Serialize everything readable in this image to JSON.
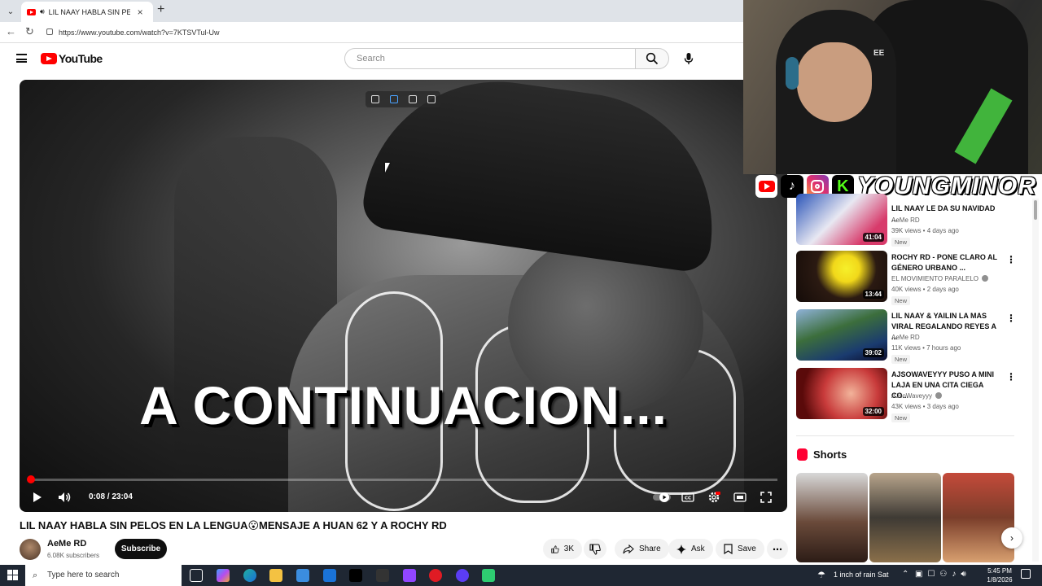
{
  "browser": {
    "tab_title": "LIL NAAY HABLA SIN PELOS E",
    "url": "https://www.youtube.com/watch?v=7KTSVTul-Uw"
  },
  "header": {
    "logo_text": "YouTube",
    "search_placeholder": "Search"
  },
  "player": {
    "overlay_text": "A CONTINUACION...",
    "time_display": "0:08 / 23:04",
    "progress_fraction": 0.0058
  },
  "video": {
    "title": "LIL NAAY HABLA SIN PELOS EN LA LENGUA😮MENSAJE A HUAN 62 Y A ROCHY RD",
    "channel_name": "AeMe RD",
    "subscribers": "6.08K subscribers",
    "subscribe_label": "Subscribe",
    "like_count": "3K",
    "share_label": "Share",
    "ask_label": "Ask",
    "save_label": "Save"
  },
  "webcam": {
    "hood_text": "EE",
    "overlay_brand": "YOUNGMINOR"
  },
  "sidebar": {
    "recommendations": [
      {
        "title": "LIL NAAY LE DA SU NAVIDAD ...",
        "channel": "AeMe RD",
        "verified": false,
        "meta": "39K views • 4 days ago",
        "badge": "New",
        "duration": "41:04"
      },
      {
        "title": "ROCHY RD - PONE CLARO AL GÉNERO URBANO ...",
        "channel": "EL MOVIMIENTO PARALELO",
        "verified": true,
        "meta": "40K views • 2 days ago",
        "badge": "New",
        "duration": "13:44"
      },
      {
        "title": "LIL NAAY & YAILIN LA MAS VIRAL REGALANDO REYES A ...",
        "channel": "AeMe RD",
        "verified": false,
        "meta": "11K views • 7 hours ago",
        "badge": "New",
        "duration": "39:02"
      },
      {
        "title": "AJSOWAVEYYY PUSO A MINI LAJA EN UNA CITA CIEGA CO...",
        "channel": "AJsoWaveyyy",
        "verified": true,
        "meta": "43K views • 3 days ago",
        "badge": "New",
        "duration": "32:00"
      }
    ],
    "shorts_label": "Shorts"
  },
  "taskbar": {
    "search_placeholder": "Type here to search",
    "weather": "1 inch of rain Sat",
    "time": "5:45 PM",
    "date": "1/8/2026"
  },
  "colors": {
    "youtube_red": "#ff0000",
    "taskbar_bg": "#1f2733"
  }
}
